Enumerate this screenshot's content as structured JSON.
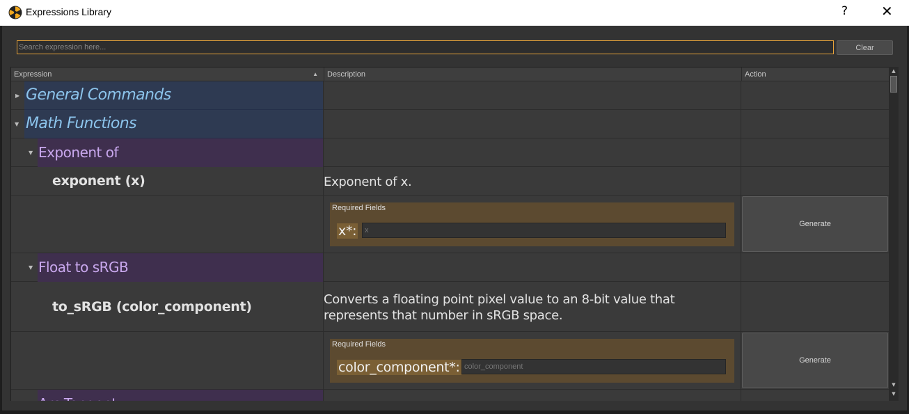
{
  "window": {
    "title": "Expressions Library",
    "help_label": "?",
    "close_label": "✕"
  },
  "search": {
    "placeholder": "Search expression here...",
    "value": ""
  },
  "toolbar": {
    "clear_label": "Clear"
  },
  "table": {
    "columns": [
      "Expression",
      "Description",
      "Action"
    ],
    "sort_column": "Expression",
    "sort_direction": "ascending"
  },
  "categories": [
    {
      "label": "General Commands",
      "expanded": false
    },
    {
      "label": "Math Functions",
      "expanded": true
    }
  ],
  "subcategories": [
    {
      "label": "Exponent of",
      "expanded": true
    },
    {
      "label": "Float to sRGB",
      "expanded": true
    },
    {
      "label": "Arc Tangent",
      "expanded": true
    }
  ],
  "expressions": [
    {
      "name": "exponent (x)",
      "description": "Exponent of x.",
      "required_fields_title": "Required Fields",
      "field_label": "x*:",
      "field_placeholder": "x",
      "action_label": "Generate"
    },
    {
      "name": "to_sRGB (color_component)",
      "description_line1": "Converts a floating point pixel value to an 8-bit value that",
      "description_line2": "represents that number in sRGB space.",
      "required_fields_title": "Required Fields",
      "field_label": "color_component*:",
      "field_placeholder": "color_component",
      "action_label": "Generate"
    }
  ],
  "colors": {
    "accent": "#e8a33a",
    "category_bg": "#2e3a52",
    "category_text": "#8cc4ec",
    "subcategory_bg": "#3f2f4e",
    "subcategory_text": "#c9a8ee",
    "required_bg": "#5c4a30"
  }
}
